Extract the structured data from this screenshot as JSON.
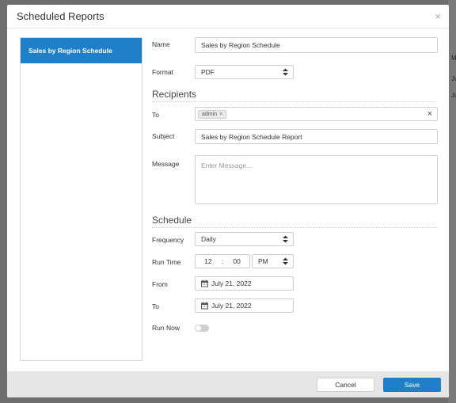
{
  "dialog": {
    "title": "Scheduled Reports",
    "close_symbol": "×"
  },
  "background": {
    "fragments": [
      "M",
      "Ju",
      "Ju"
    ]
  },
  "schedule_list": {
    "items": [
      {
        "label": "Sales by Region Schedule"
      }
    ]
  },
  "form": {
    "name_label": "Name",
    "name_value": "Sales by Region Schedule",
    "format_label": "Format",
    "format_value": "PDF",
    "recipients_title": "Recipients",
    "to_label": "To",
    "to_chip": "admin",
    "chip_remove": "×",
    "clear_symbol": "×",
    "subject_label": "Subject",
    "subject_value": "Sales by Region Schedule Report",
    "message_label": "Message",
    "message_placeholder": "Enter Message...",
    "schedule_title": "Schedule",
    "frequency_label": "Frequency",
    "frequency_value": "Daily",
    "run_time_label": "Run Time",
    "hour": "12",
    "time_sep": ":",
    "minute": "00",
    "ampm": "PM",
    "from_label": "From",
    "from_value": "July 21, 2022",
    "to_date_label": "To",
    "to_date_value": "July 21, 2022",
    "run_now_label": "Run Now",
    "run_now_on": false
  },
  "footer": {
    "cancel_label": "Cancel",
    "save_label": "Save"
  },
  "colors": {
    "accent": "#1f80c9",
    "overlay": "#6e6e6e",
    "footer": "#e6e6e6"
  }
}
